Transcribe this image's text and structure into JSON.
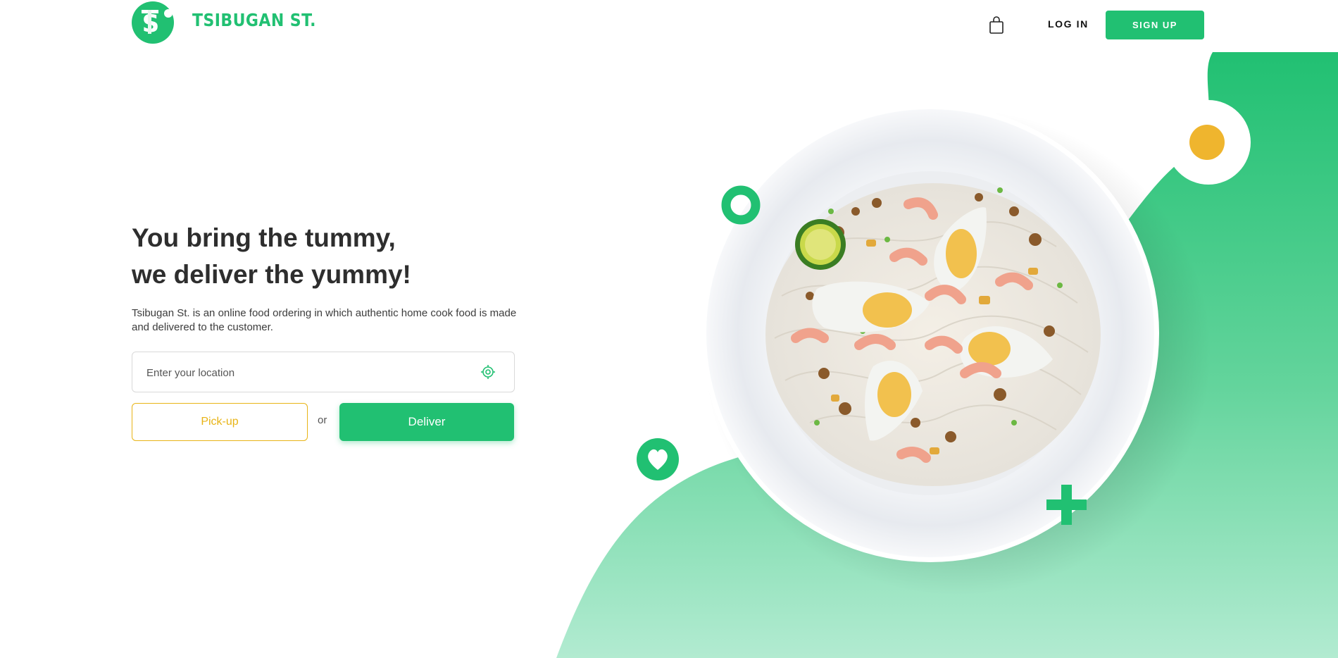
{
  "brand": {
    "name": "TSIBUGAN ST.",
    "logo_icon": "ts-monogram-logo"
  },
  "nav": {
    "cart_icon": "shopping-bag-icon",
    "login_label": "LOG IN",
    "signup_label": "SIGN UP"
  },
  "hero": {
    "title_line1": "You bring the tummy,",
    "title_line2": "we deliver the yummy!",
    "description": "Tsibugan St. is an online food ordering in which authentic home cook food is made and delivered to the customer.",
    "location_placeholder": "Enter your location",
    "location_icon": "target-location-icon",
    "pickup_label": "Pick-up",
    "or_label": "or",
    "deliver_label": "Deliver"
  },
  "colors": {
    "brand_green": "#21c072",
    "accent_yellow": "#efb52e",
    "light_green": "#aee9cd",
    "text_dark": "#2e2e2e"
  }
}
